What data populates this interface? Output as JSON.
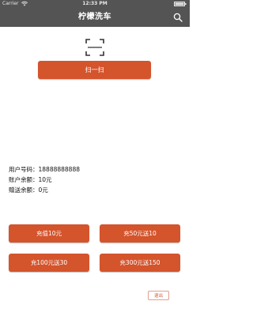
{
  "status_bar": {
    "carrier": "Carrier",
    "time": "12:33 PM"
  },
  "header": {
    "title": "柠檬洗车"
  },
  "scan": {
    "button_label": "扫一扫"
  },
  "account": {
    "phone_label": "用户号码：",
    "phone_value": "18888888888",
    "balance_label": "账户余额：",
    "balance_value": "10元",
    "gift_label": "赠送余额：",
    "gift_value": "0元"
  },
  "recharge_options": [
    {
      "label": "充值10元"
    },
    {
      "label": "充50元送10"
    },
    {
      "label": "充100元送30"
    },
    {
      "label": "充300元送150"
    }
  ],
  "footer": {
    "logout_label": "退出"
  },
  "colors": {
    "header_bg": "#545454",
    "accent": "#d4542c"
  }
}
